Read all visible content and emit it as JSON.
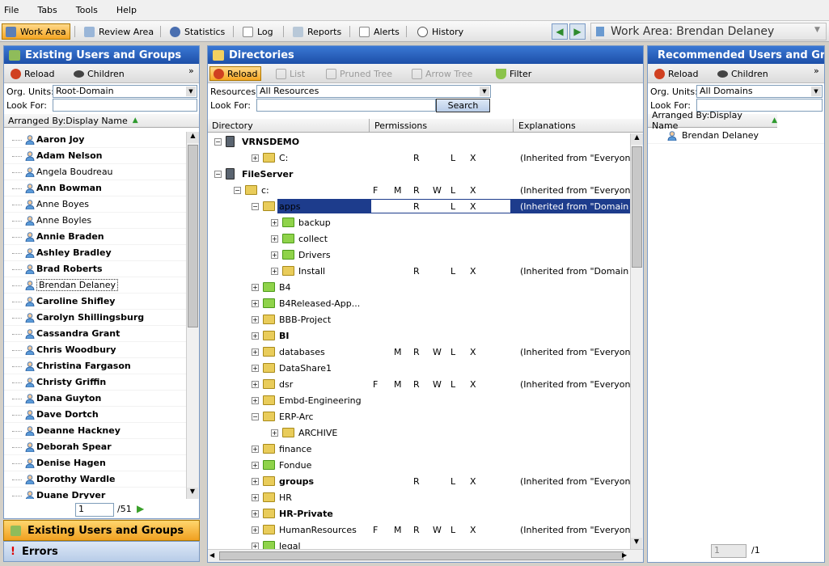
{
  "menu": [
    "File",
    "Tabs",
    "Tools",
    "Help"
  ],
  "toolbar": {
    "items": [
      "Work Area",
      "Review Area",
      "Statistics",
      "Log",
      "Reports",
      "Alerts",
      "History"
    ],
    "title": "Work Area: Brendan  Delaney"
  },
  "left": {
    "title": "Existing Users and Groups",
    "reload": "Reload",
    "children": "Children",
    "org_label": "Org. Units:",
    "org_value": "Root-Domain",
    "look_label": "Look For:",
    "arranged": "Arranged By:Display Name",
    "users": [
      {
        "n": "Aaron Joy",
        "b": true
      },
      {
        "n": "Adam Nelson",
        "b": true
      },
      {
        "n": "Angela Boudreau",
        "b": false
      },
      {
        "n": "Ann Bowman",
        "b": true
      },
      {
        "n": "Anne Boyes",
        "b": false
      },
      {
        "n": "Anne Boyles",
        "b": false
      },
      {
        "n": "Annie Braden",
        "b": true
      },
      {
        "n": "Ashley Bradley",
        "b": true
      },
      {
        "n": "Brad Roberts",
        "b": true
      },
      {
        "n": "Brendan Delaney",
        "b": false
      },
      {
        "n": "Caroline Shifley",
        "b": true
      },
      {
        "n": "Carolyn Shillingsburg",
        "b": true
      },
      {
        "n": "Cassandra Grant",
        "b": true
      },
      {
        "n": "Chris Woodbury",
        "b": true
      },
      {
        "n": "Christina Fargason",
        "b": true
      },
      {
        "n": "Christy Griffin",
        "b": true
      },
      {
        "n": "Dana Guyton",
        "b": true
      },
      {
        "n": "Dave Dortch",
        "b": true
      },
      {
        "n": "Deanne Hackney",
        "b": true
      },
      {
        "n": "Deborah Spear",
        "b": true
      },
      {
        "n": "Denise Hagen",
        "b": true
      },
      {
        "n": "Dorothy Wardle",
        "b": true
      },
      {
        "n": "Duane Dryver",
        "b": true
      }
    ],
    "page": "1",
    "pages": "/51",
    "tab1": "Existing Users and Groups",
    "tab2": "Errors"
  },
  "center": {
    "title": "Directories",
    "buttons": [
      "Reload",
      "List",
      "Pruned Tree",
      "Arrow Tree",
      "Filter"
    ],
    "res_label": "Resources:",
    "res_value": "All Resources",
    "look_label": "Look For:",
    "search": "Search",
    "cols": [
      "Directory",
      "Permissions",
      "Explanations"
    ],
    "rows": [
      {
        "t": "VRNSDEMO",
        "x": 0,
        "b": true,
        "k": "srv",
        "p": [
          "",
          "",
          "",
          "",
          "",
          ""
        ],
        "e": ""
      },
      {
        "t": "C:",
        "x": 2,
        "b": false,
        "k": "lock",
        "p": [
          "",
          "",
          "R",
          "",
          "L",
          "X"
        ],
        "e": "(Inherited from \"Everyone\")"
      },
      {
        "t": "FileServer",
        "x": 0,
        "b": true,
        "k": "srv",
        "p": [
          "",
          "",
          "",
          "",
          "",
          ""
        ],
        "e": ""
      },
      {
        "t": "c:",
        "x": 1,
        "b": false,
        "k": "lock",
        "p": [
          "F",
          "M",
          "R",
          "W",
          "L",
          "X"
        ],
        "e": "(Inherited from \"Everyone\")"
      },
      {
        "t": "apps",
        "x": 2,
        "b": false,
        "k": "lock",
        "p": [
          "",
          "",
          "R",
          "",
          "L",
          "X"
        ],
        "e": "(Inherited from \"Domain Users\")",
        "sel": true
      },
      {
        "t": "backup",
        "x": 3,
        "b": false,
        "k": "f",
        "p": [
          "",
          "",
          "",
          "",
          "",
          ""
        ],
        "e": ""
      },
      {
        "t": "collect",
        "x": 3,
        "b": false,
        "k": "f",
        "p": [
          "",
          "",
          "",
          "",
          "",
          ""
        ],
        "e": ""
      },
      {
        "t": "Drivers",
        "x": 3,
        "b": false,
        "k": "f",
        "p": [
          "",
          "",
          "",
          "",
          "",
          ""
        ],
        "e": ""
      },
      {
        "t": "Install",
        "x": 3,
        "b": false,
        "k": "lock",
        "p": [
          "",
          "",
          "R",
          "",
          "L",
          "X"
        ],
        "e": "(Inherited from \"Domain Users\")"
      },
      {
        "t": "B4",
        "x": 2,
        "b": false,
        "k": "f",
        "p": [
          "",
          "",
          "",
          "",
          "",
          ""
        ],
        "e": ""
      },
      {
        "t": "B4Released-App...",
        "x": 2,
        "b": false,
        "k": "f",
        "p": [
          "",
          "",
          "",
          "",
          "",
          ""
        ],
        "e": ""
      },
      {
        "t": "BBB-Project",
        "x": 2,
        "b": false,
        "k": "lock",
        "p": [
          "",
          "",
          "",
          "",
          "",
          ""
        ],
        "e": ""
      },
      {
        "t": "BI",
        "x": 2,
        "b": true,
        "k": "lock",
        "p": [
          "",
          "",
          "",
          "",
          "",
          ""
        ],
        "e": ""
      },
      {
        "t": "databases",
        "x": 2,
        "b": false,
        "k": "lock",
        "p": [
          "",
          "M",
          "R",
          "W",
          "L",
          "X"
        ],
        "e": "(Inherited from \"Everyone\")"
      },
      {
        "t": "DataShare1",
        "x": 2,
        "b": false,
        "k": "lock",
        "p": [
          "",
          "",
          "",
          "",
          "",
          ""
        ],
        "e": ""
      },
      {
        "t": "dsr",
        "x": 2,
        "b": false,
        "k": "lock",
        "p": [
          "F",
          "M",
          "R",
          "W",
          "L",
          "X"
        ],
        "e": "(Inherited from \"Everyone\")"
      },
      {
        "t": "Embd-Engineering",
        "x": 2,
        "b": false,
        "k": "lock",
        "p": [
          "",
          "",
          "",
          "",
          "",
          ""
        ],
        "e": ""
      },
      {
        "t": "ERP-Arc",
        "x": 2,
        "b": false,
        "k": "lock",
        "p": [
          "",
          "",
          "",
          "",
          "",
          ""
        ],
        "e": ""
      },
      {
        "t": "ARCHIVE",
        "x": 3,
        "b": false,
        "k": "lock",
        "p": [
          "",
          "",
          "",
          "",
          "",
          ""
        ],
        "e": ""
      },
      {
        "t": "finance",
        "x": 2,
        "b": false,
        "k": "lock",
        "p": [
          "",
          "",
          "",
          "",
          "",
          ""
        ],
        "e": ""
      },
      {
        "t": "Fondue",
        "x": 2,
        "b": false,
        "k": "f",
        "p": [
          "",
          "",
          "",
          "",
          "",
          ""
        ],
        "e": ""
      },
      {
        "t": "groups",
        "x": 2,
        "b": true,
        "k": "lock",
        "p": [
          "",
          "",
          "R",
          "",
          "L",
          "X"
        ],
        "e": "(Inherited from \"Everyone\")"
      },
      {
        "t": "HR",
        "x": 2,
        "b": false,
        "k": "lock",
        "p": [
          "",
          "",
          "",
          "",
          "",
          ""
        ],
        "e": ""
      },
      {
        "t": "HR-Private",
        "x": 2,
        "b": true,
        "k": "lock",
        "p": [
          "",
          "",
          "",
          "",
          "",
          ""
        ],
        "e": ""
      },
      {
        "t": "HumanResources",
        "x": 2,
        "b": false,
        "k": "lock",
        "p": [
          "F",
          "M",
          "R",
          "W",
          "L",
          "X"
        ],
        "e": "(Inherited from \"Everyone\")"
      },
      {
        "t": "legal",
        "x": 2,
        "b": false,
        "k": "f",
        "p": [
          "",
          "",
          "",
          "",
          "",
          ""
        ],
        "e": ""
      }
    ]
  },
  "right": {
    "title": "Recommended Users and Groups",
    "reload": "Reload",
    "children": "Children",
    "org_label": "Org. Units:",
    "org_value": "All Domains",
    "look_label": "Look For:",
    "arranged": "Arranged By:Display Name",
    "users": [
      "Brendan  Delaney"
    ],
    "page": "1",
    "pages": "/1"
  }
}
